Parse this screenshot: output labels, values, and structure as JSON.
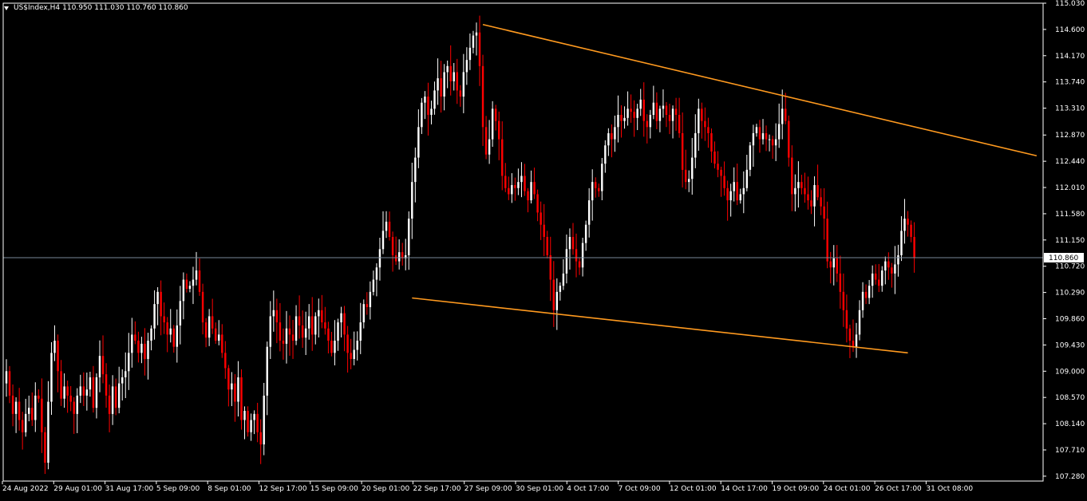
{
  "header": {
    "symbol": "US$Index,H4",
    "ohlc": "110.950 111.030 110.760 110.860"
  },
  "colors": {
    "background": "#000000",
    "bull_candle": "#ffffff",
    "bear_candle": "#ff0000",
    "trendline": "#ff9a1f",
    "axis": "#ffffff",
    "price_line": "#778899"
  },
  "chart_data": {
    "type": "candlestick",
    "symbol": "US$Index",
    "timeframe": "H4",
    "grid": false,
    "ylim": [
      107.2,
      115.03
    ],
    "y_ticks": [
      "115.030",
      "114.600",
      "114.170",
      "113.740",
      "113.310",
      "112.870",
      "112.440",
      "112.010",
      "111.580",
      "111.150",
      "110.720",
      "110.290",
      "109.860",
      "109.430",
      "109.000",
      "108.570",
      "108.140",
      "107.710",
      "107.280"
    ],
    "x_ticks": [
      "24 Aug 2022",
      "29 Aug 01:00",
      "31 Aug 17:00",
      "5 Sep 09:00",
      "8 Sep 01:00",
      "12 Sep 17:00",
      "15 Sep 09:00",
      "20 Sep 01:00",
      "22 Sep 17:00",
      "27 Sep 09:00",
      "30 Sep 01:00",
      "4 Oct 17:00",
      "7 Oct 09:00",
      "12 Oct 01:00",
      "14 Oct 17:00",
      "19 Oct 09:00",
      "24 Oct 01:00",
      "26 Oct 17:00",
      "31 Oct 08:00"
    ],
    "current_price": "110.860",
    "trendlines": [
      {
        "from": {
          "bar": 148,
          "price": 114.68
        },
        "to": {
          "bar": 320,
          "price": 112.53
        }
      },
      {
        "from": {
          "bar": 126,
          "price": 110.2
        },
        "to": {
          "bar": 280,
          "price": 109.3
        }
      }
    ],
    "closes": [
      109.0,
      108.6,
      108.3,
      108.5,
      108.2,
      108.0,
      108.3,
      108.4,
      108.2,
      108.6,
      108.55,
      108.0,
      107.5,
      108.5,
      109.3,
      109.5,
      109.0,
      108.55,
      108.75,
      108.6,
      108.5,
      108.3,
      108.6,
      108.75,
      108.6,
      108.7,
      108.9,
      108.4,
      108.9,
      109.25,
      108.95,
      108.6,
      108.3,
      108.75,
      108.4,
      108.8,
      108.9,
      109.0,
      109.3,
      109.6,
      109.5,
      109.3,
      109.45,
      109.2,
      109.5,
      109.7,
      110.1,
      110.3,
      109.9,
      109.8,
      109.6,
      109.7,
      109.4,
      109.75,
      110.15,
      110.5,
      110.35,
      110.4,
      110.5,
      110.65,
      110.3,
      109.8,
      109.55,
      109.9,
      109.7,
      109.5,
      109.6,
      109.3,
      109.05,
      108.7,
      108.8,
      108.5,
      108.9,
      108.2,
      108.35,
      108.0,
      108.2,
      108.3,
      108.0,
      107.8,
      108.6,
      109.4,
      109.9,
      110.0,
      109.8,
      109.5,
      109.45,
      109.7,
      109.6,
      109.5,
      109.9,
      109.75,
      109.55,
      109.7,
      109.9,
      109.6,
      109.9,
      110.0,
      109.8,
      109.7,
      109.5,
      109.3,
      109.5,
      109.8,
      109.95,
      109.6,
      109.3,
      109.2,
      109.35,
      109.5,
      109.8,
      110.1,
      110.05,
      110.3,
      110.5,
      110.7,
      111.0,
      111.3,
      111.45,
      111.2,
      110.9,
      110.8,
      110.95,
      110.85,
      110.9,
      111.5,
      112.1,
      112.5,
      113.0,
      113.4,
      113.5,
      113.2,
      113.3,
      113.6,
      113.8,
      113.5,
      113.9,
      114.0,
      113.75,
      113.9,
      113.6,
      113.5,
      113.9,
      114.1,
      114.3,
      114.5,
      114.55,
      114.0,
      113.0,
      112.55,
      112.8,
      113.3,
      113.1,
      112.8,
      112.2,
      112.0,
      111.9,
      112.05,
      112.0,
      112.1,
      112.2,
      111.95,
      111.8,
      112.1,
      111.9,
      111.6,
      111.4,
      111.2,
      110.9,
      110.5,
      110.0,
      110.3,
      110.4,
      110.6,
      111.0,
      111.2,
      111.0,
      110.8,
      110.7,
      111.1,
      111.4,
      111.8,
      112.1,
      112.0,
      111.95,
      112.4,
      112.7,
      112.9,
      112.8,
      113.0,
      113.2,
      113.1,
      113.15,
      113.3,
      113.25,
      113.15,
      113.3,
      113.45,
      113.1,
      113.0,
      113.2,
      113.4,
      113.1,
      113.3,
      113.35,
      113.2,
      113.1,
      113.3,
      113.2,
      112.9,
      112.3,
      112.1,
      112.15,
      112.5,
      112.9,
      113.3,
      113.1,
      113.0,
      112.9,
      112.6,
      112.4,
      112.3,
      112.2,
      112.0,
      111.8,
      111.95,
      112.1,
      111.8,
      111.9,
      112.0,
      112.3,
      112.7,
      112.9,
      113.0,
      112.8,
      112.9,
      112.8,
      112.8,
      112.7,
      112.8,
      113.05,
      113.3,
      113.1,
      112.5,
      111.9,
      112.0,
      112.1,
      112.0,
      111.9,
      111.8,
      111.7,
      112.05,
      111.85,
      111.7,
      111.5,
      110.8,
      110.7,
      110.85,
      110.6,
      110.3,
      110.0,
      109.7,
      109.5,
      109.4,
      109.6,
      110.0,
      110.3,
      110.2,
      110.4,
      110.6,
      110.5,
      110.4,
      110.65,
      110.8,
      110.7,
      110.6,
      110.75,
      110.9,
      111.3,
      111.5,
      111.4,
      111.2,
      110.86
    ],
    "visible_bars": 323
  }
}
